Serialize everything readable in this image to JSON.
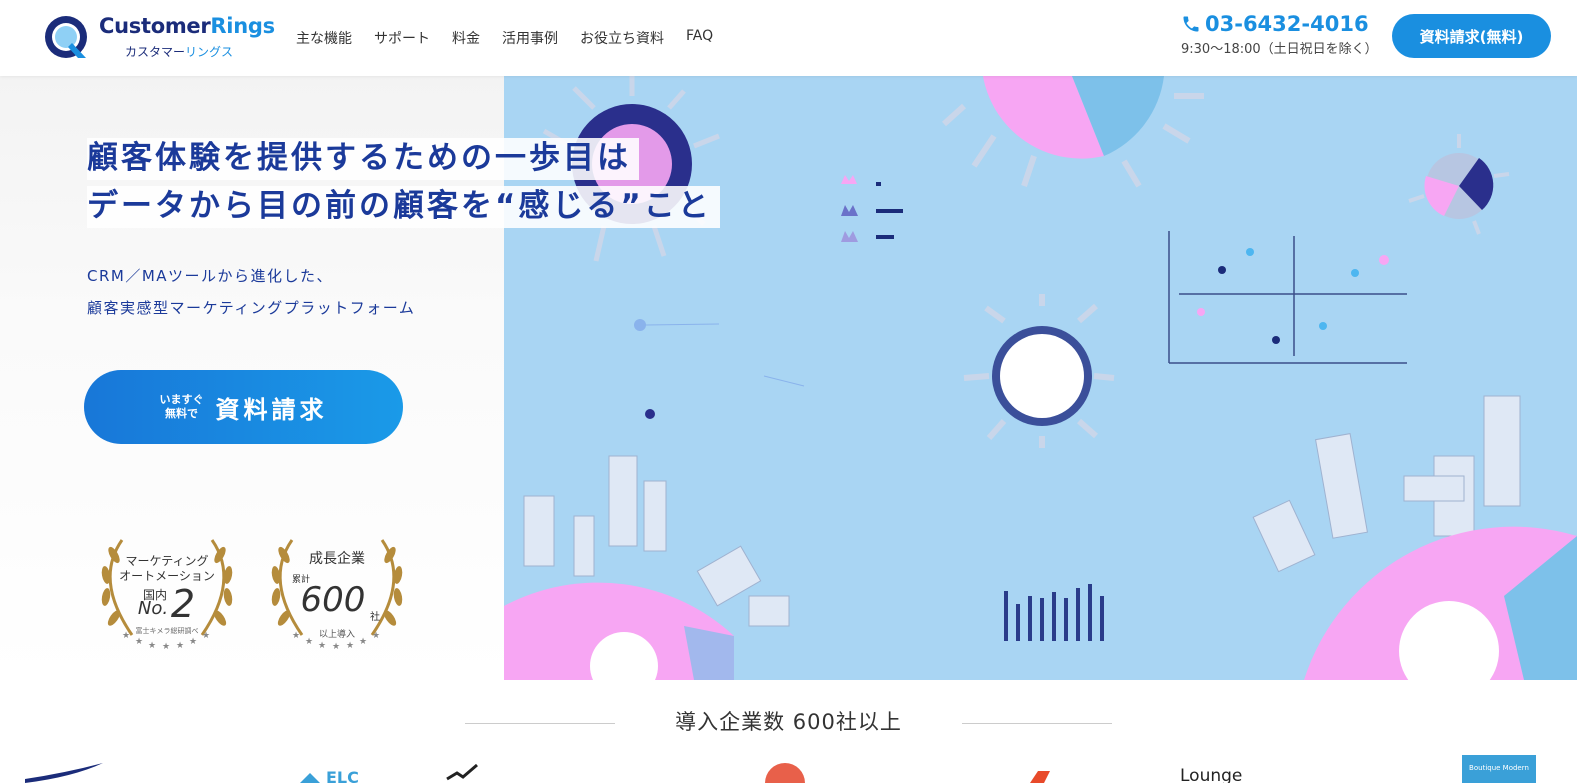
{
  "header": {
    "logo_en_1": "Customer",
    "logo_en_2": "Rings",
    "logo_jp_1": "カスタマー",
    "logo_jp_2": "リングス",
    "nav": [
      "主な機能",
      "サポート",
      "料金",
      "活用事例",
      "お役立ち資料",
      "FAQ"
    ],
    "phone": "03-6432-4016",
    "hours": "9:30〜18:00（土日祝日を除く）",
    "cta_label": "資料請求(無料)"
  },
  "hero": {
    "headline_1": "顧客体験を提供するための一歩目は",
    "headline_2": "データから目の前の顧客を“感じる”こと",
    "sub_1": "CRM／MAツールから進化した、",
    "sub_2": "顧客実感型マーケティングプラットフォーム",
    "cta_small_1": "いますぐ",
    "cta_small_2": "無料で",
    "cta_big": "資料請求"
  },
  "badges": [
    {
      "line1": "マーケティング",
      "line2": "オートメーション",
      "line3": "国内",
      "prefix": "No.",
      "value": "2",
      "note": "富士キメラ総研調べ"
    },
    {
      "line1": "成長企業",
      "line2": "累計",
      "value": "600",
      "suffix": "社",
      "note": "以上導入"
    }
  ],
  "clients": {
    "title": "導入企業数 600社以上",
    "visible_logo_text": [
      "Lounge",
      "Boutique Modern"
    ]
  },
  "colors": {
    "brand_blue": "#1a8fe0",
    "navy": "#1b3a9a",
    "hero_bg": "#a9d5f3",
    "pink": "#f7a6f3",
    "gold": "#b58c3c"
  }
}
